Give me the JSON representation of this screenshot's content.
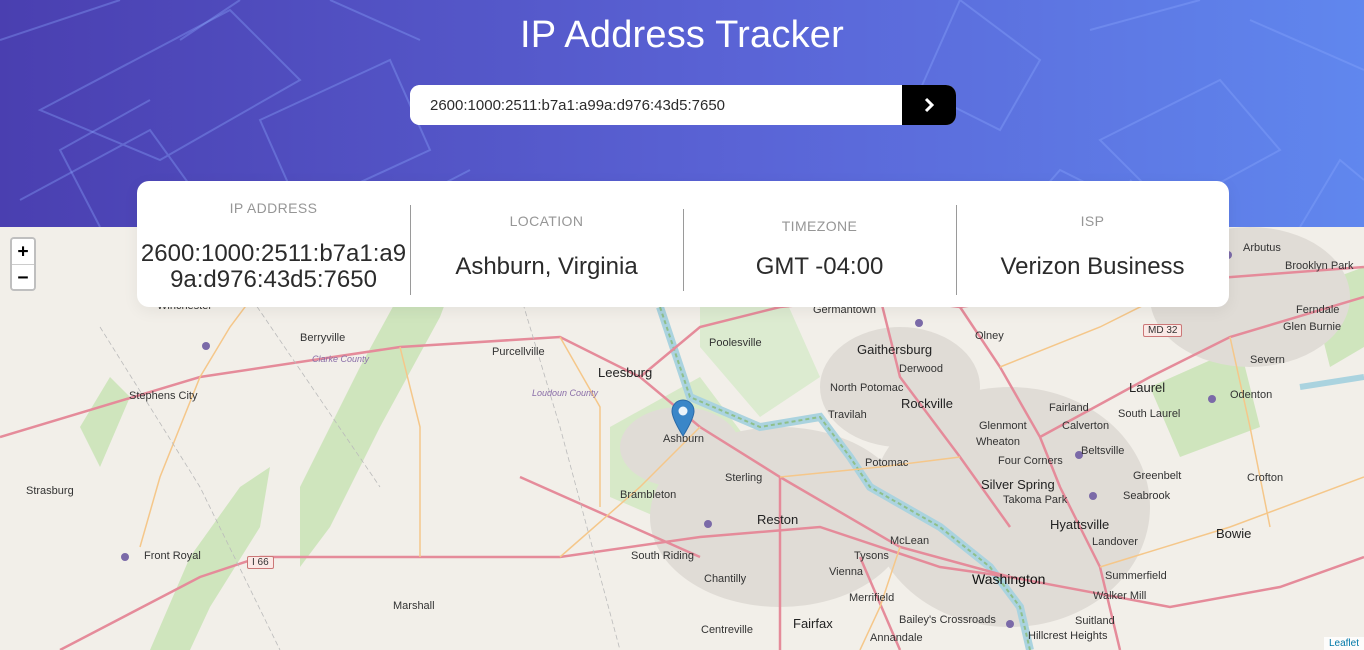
{
  "header": {
    "title": "IP Address Tracker",
    "search": {
      "value": "2600:1000:2511:b7a1:a99a:d976:43d5:7650",
      "submit_icon": "chevron-right-icon"
    }
  },
  "info": {
    "ip_label": "IP ADDRESS",
    "ip_value": "2600:1000:2511:b7a1:a99a:d976:43d5:7650",
    "location_label": "LOCATION",
    "location_value": "Ashburn, Virginia",
    "timezone_label": "TIMEZONE",
    "timezone_value": "GMT -04:00",
    "isp_label": "ISP",
    "isp_value": "Verizon Business"
  },
  "map": {
    "zoom_in": "+",
    "zoom_out": "−",
    "attribution": "Leaflet",
    "places": {
      "winchester": "Winchester",
      "berryville": "Berryville",
      "purcellville": "Purcellville",
      "leesburg": "Leesburg",
      "poolesville": "Poolesville",
      "germantown": "Germantown",
      "gaithersburg": "Gaithersburg",
      "olney": "Olney",
      "laurel": "Laurel",
      "ashburn": "Ashburn",
      "sterling": "Sterling",
      "reston": "Reston",
      "brambleton": "Brambleton",
      "south_riding": "South Riding",
      "chantilly": "Chantilly",
      "centreville": "Centreville",
      "fairfax": "Fairfax",
      "vienna": "Vienna",
      "tysons": "Tysons",
      "mclean": "McLean",
      "washington": "Washington",
      "rockville": "Rockville",
      "potomac": "Potomac",
      "north_potomac": "North Potomac",
      "travilah": "Travilah",
      "derwood": "Derwood",
      "silver_spring": "Silver Spring",
      "takoma_park": "Takoma Park",
      "hyattsville": "Hyattsville",
      "wheaton": "Wheaton",
      "glenmont": "Glenmont",
      "four_corners": "Four Corners",
      "fairland": "Fairland",
      "south_laurel": "South Laurel",
      "calverton": "Calverton",
      "beltsville": "Beltsville",
      "greenbelt": "Greenbelt",
      "seabrook": "Seabrook",
      "landover": "Landover",
      "summerfield": "Summerfield",
      "walker_mill": "Walker Mill",
      "suitland": "Suitland",
      "hillcrest_heights": "Hillcrest Heights",
      "bowie": "Bowie",
      "crofton": "Crofton",
      "odenton": "Odenton",
      "severn": "Severn",
      "glen_burnie": "Glen Burnie",
      "ferndale": "Ferndale",
      "brooklyn_park": "Brooklyn Park",
      "arbutus": "Arbutus",
      "stephens_city": "Stephens City",
      "strasburg": "Strasburg",
      "front_royal": "Front Royal",
      "marshall": "Marshall",
      "merrifield": "Merrifield",
      "baileys_crossroads": "Bailey's Crossroads",
      "annandale": "Annandale",
      "clarke_county": "Clarke County",
      "loudoun_county": "Loudoun County",
      "i66": "I 66",
      "md32": "MD 32"
    }
  }
}
